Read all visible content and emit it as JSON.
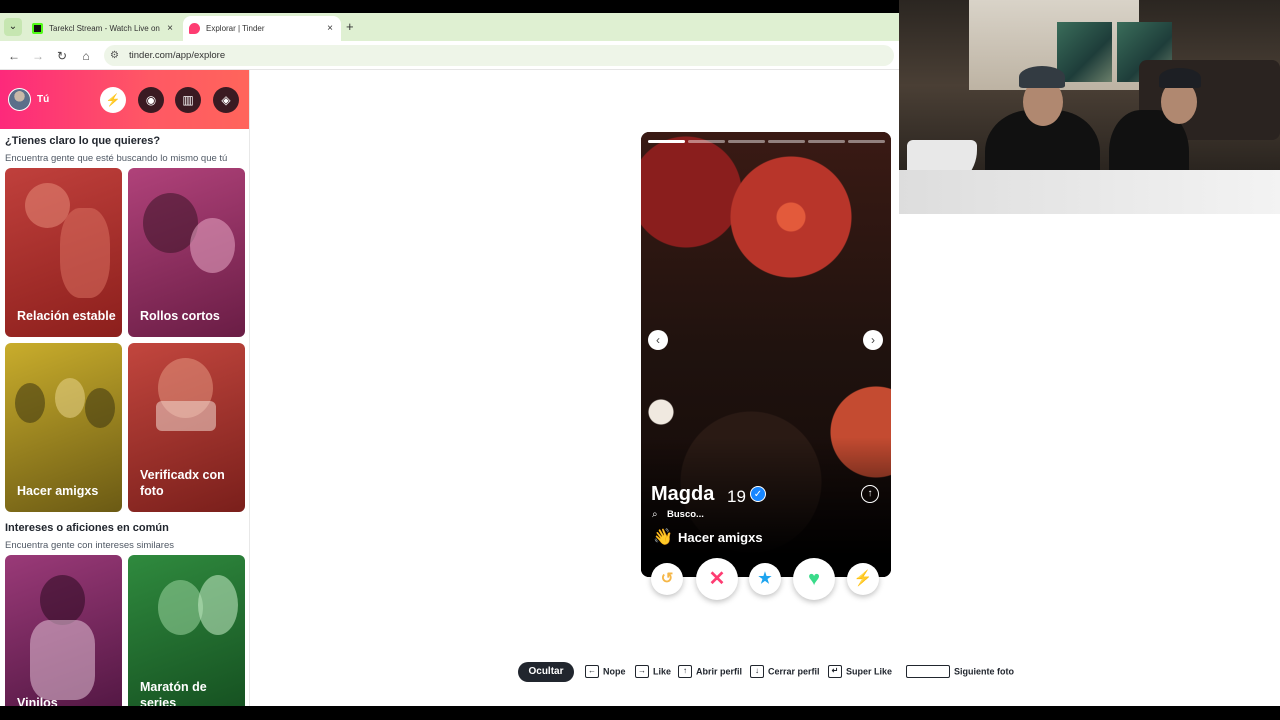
{
  "browser": {
    "tabs": [
      {
        "title": "Tarekcl Stream - Watch Live on",
        "close": "×"
      },
      {
        "title": "Explorar | Tinder",
        "close": "×"
      }
    ],
    "new_tab": "+",
    "url": "tinder.com/app/explore",
    "nav": {
      "back": "←",
      "forward": "→",
      "reload": "↻",
      "home": "⌂",
      "tab_menu": "⌄",
      "site_info": "⚙"
    }
  },
  "sidebar": {
    "user_label": "Tú",
    "header_buttons": [
      {
        "icon": "lightning-icon",
        "glyph": "⚡"
      },
      {
        "icon": "compass-icon",
        "glyph": "◉"
      },
      {
        "icon": "briefcase-icon",
        "glyph": "▥"
      },
      {
        "icon": "shield-icon",
        "glyph": "◈"
      }
    ],
    "section1": {
      "title": "¿Tienes claro lo que quieres?",
      "subtitle": "Encuentra gente que esté buscando lo mismo que tú",
      "cards": [
        "Relación estable",
        "Rollos cortos",
        "Hacer amigxs",
        "Verificadx con foto"
      ]
    },
    "section2": {
      "title": "Intereses o aficiones en común",
      "subtitle": "Encuentra gente con intereses similares",
      "cards": [
        "Vinilos",
        "Maratón de series"
      ]
    }
  },
  "profile": {
    "name": "Magda",
    "age": "19",
    "verified_glyph": "✓",
    "looking_for": "Busco...",
    "goal_emoji": "👋",
    "goal": "Hacer amigxs",
    "prev_arrow": "‹",
    "next_arrow": "›",
    "expand_glyph": "↑",
    "photo_count": 6,
    "current_photo": 1
  },
  "actions": [
    {
      "name": "rewind",
      "glyph": "↺",
      "color": "#f5b748"
    },
    {
      "name": "nope",
      "glyph": "✕",
      "color": "#fe3c72"
    },
    {
      "name": "super-like",
      "glyph": "★",
      "color": "#1ea4ef"
    },
    {
      "name": "like",
      "glyph": "♥",
      "color": "#3adb8a"
    },
    {
      "name": "boost",
      "glyph": "⚡",
      "color": "#a84bf0"
    }
  ],
  "shortcuts": {
    "hide": "Ocultar",
    "items": [
      {
        "key": "←",
        "label": "Nope"
      },
      {
        "key": "→",
        "label": "Like"
      },
      {
        "key": "↑",
        "label": "Abrir perfil"
      },
      {
        "key": "↓",
        "label": "Cerrar perfil"
      },
      {
        "key": "↵",
        "label": "Super Like"
      },
      {
        "key": "",
        "label": "Siguiente foto"
      }
    ]
  }
}
